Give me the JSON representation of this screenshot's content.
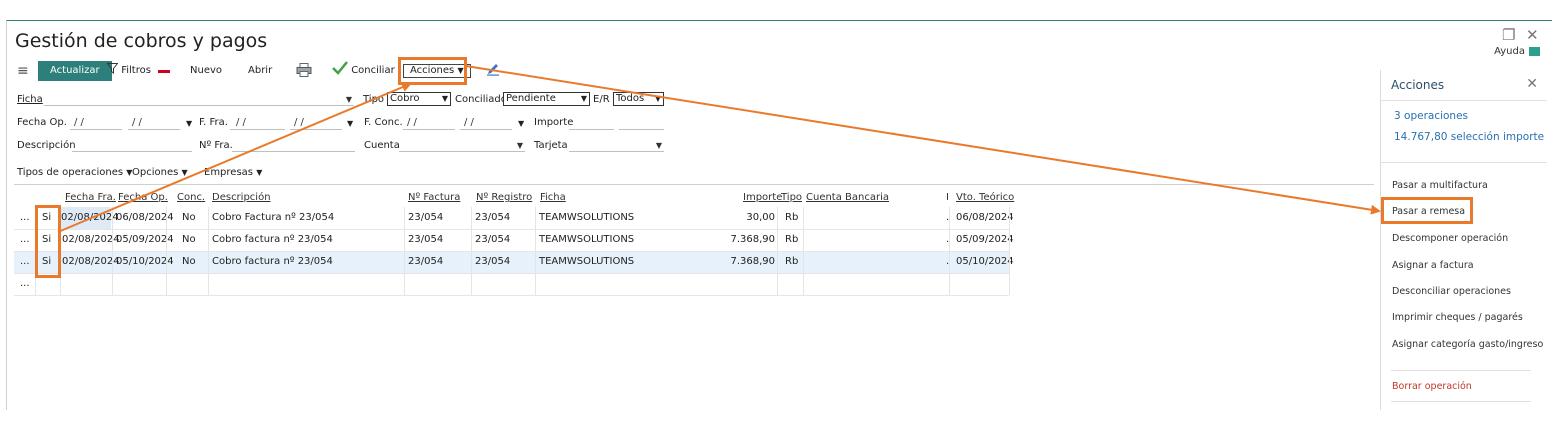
{
  "window": {
    "title": "Gestión de cobros y pagos",
    "restore_glyph": "❐",
    "close_glyph": "✕",
    "help_label": "Ayuda"
  },
  "toolbar": {
    "menu_glyph": "≡",
    "actualizar": "Actualizar",
    "filtros": "Filtros",
    "nuevo": "Nuevo",
    "abrir": "Abrir",
    "conciliar": "Conciliar",
    "acciones": "Acciones",
    "colors": {
      "accent": "#2c7f7a",
      "highlight": "#e97a2b",
      "remove": "#d0021b",
      "check": "#43a047"
    }
  },
  "filters": {
    "ficha_label": "Ficha",
    "tipo_label": "Tipo",
    "tipo_value": "Cobro",
    "conciliado_label": "Conciliado",
    "conciliado_value": "Pendiente",
    "er_label": "E/R",
    "er_value": "Todos",
    "fecha_op_label": "Fecha Op.",
    "fecha_op_from": "/  /",
    "fecha_op_to": "/  /",
    "f_fra_label": "F. Fra.",
    "f_fra_from": "/  /",
    "f_fra_to": "/  /",
    "f_conc_label": "F. Conc.",
    "f_conc_from": "/  /",
    "f_conc_to": "/  /",
    "importe_label": "Importe",
    "descripcion_label": "Descripción",
    "n_fra_label": "Nº Fra.",
    "cuenta_label": "Cuenta",
    "tarjeta_label": "Tarjeta",
    "tipos_operaciones": "Tipos de operaciones",
    "opciones": "Opciones",
    "empresas": "Empresas"
  },
  "table": {
    "headers": {
      "fecha_fra": "Fecha Fra.",
      "fecha_op": "Fecha Op.",
      "conc": "Conc.",
      "descripcion": "Descripción",
      "n_factura": "Nº Factura",
      "n_registro": "Nº Registro",
      "ficha": "Ficha",
      "importe": "Importe",
      "tipo": "Tipo",
      "cuenta_bancaria": "Cuenta Bancaria",
      "trunc": "I",
      "vto_teorico": "Vto. Teórico"
    },
    "rows": [
      {
        "dots": "...",
        "flag": "Si",
        "fecha_fra": "02/08/2024",
        "fecha_op": "06/08/2024",
        "conc": "No",
        "descripcion": "Cobro Factura nº 23/054",
        "n_factura": "23/054",
        "n_registro": "23/054",
        "ficha": "TEAMWSOLUTIONS",
        "importe": "30,00",
        "tipo": "Rb",
        "trunc": ".",
        "vto": "06/08/2024"
      },
      {
        "dots": "...",
        "flag": "Si",
        "fecha_fra": "02/08/2024",
        "fecha_op": "05/09/2024",
        "conc": "No",
        "descripcion": "Cobro factura nº 23/054",
        "n_factura": "23/054",
        "n_registro": "23/054",
        "ficha": "TEAMWSOLUTIONS",
        "importe": "7.368,90",
        "tipo": "Rb",
        "trunc": ".",
        "vto": "05/09/2024"
      },
      {
        "dots": "...",
        "flag": "Si",
        "fecha_fra": "02/08/2024",
        "fecha_op": "05/10/2024",
        "conc": "No",
        "descripcion": "Cobro factura nº 23/054",
        "n_factura": "23/054",
        "n_registro": "23/054",
        "ficha": "TEAMWSOLUTIONS",
        "importe": "7.368,90",
        "tipo": "Rb",
        "trunc": ".",
        "vto": "05/10/2024"
      }
    ],
    "new_row_dots": "..."
  },
  "panel": {
    "title": "Acciones",
    "close_glyph": "✕",
    "operaciones": "3 operaciones",
    "seleccion": "14.767,80 selección importe",
    "items": [
      "Pasar a multifactura",
      "Pasar a remesa",
      "Descomponer operación",
      "Asignar a factura",
      "Desconciliar operaciones",
      "Imprimir cheques / pagarés",
      "Asignar categoría gasto/ingreso"
    ],
    "danger_item": "Borrar operación"
  }
}
